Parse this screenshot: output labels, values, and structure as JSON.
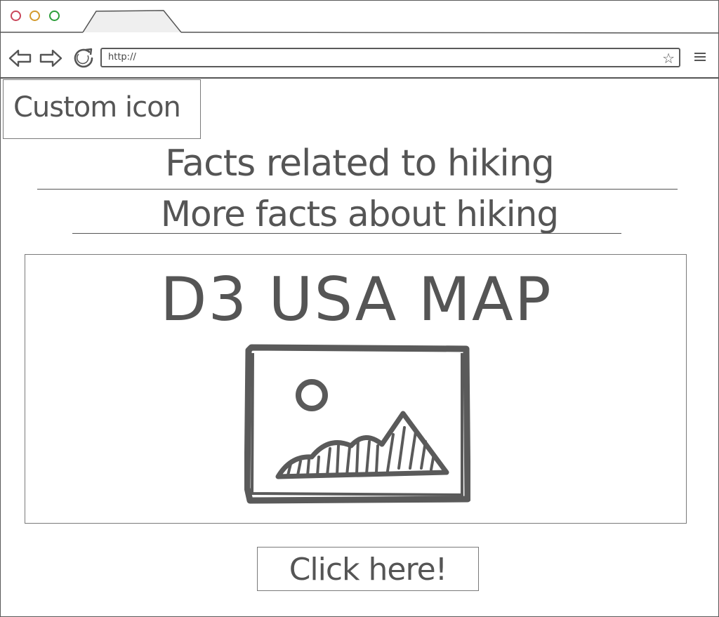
{
  "browser": {
    "url": "http://",
    "icons": {
      "back": "arrow-left-icon",
      "forward": "arrow-right-icon",
      "reload": "reload-icon",
      "bookmark": "star-icon",
      "menu": "hamburger-icon"
    },
    "traffic_light_colors": {
      "close": "#c9465a",
      "minimize": "#d39a2c",
      "maximize": "#2d9e3a"
    }
  },
  "page": {
    "custom_icon_label": "Custom icon",
    "heading_primary": "Facts related to hiking",
    "heading_secondary": "More facts about hiking",
    "map_title": "D3 USA MAP",
    "map_image_icon": "image-placeholder-icon",
    "cta_label": "Click here!"
  },
  "colors": {
    "ink": "#555555",
    "border": "#7a7a7a",
    "background": "#ffffff"
  }
}
